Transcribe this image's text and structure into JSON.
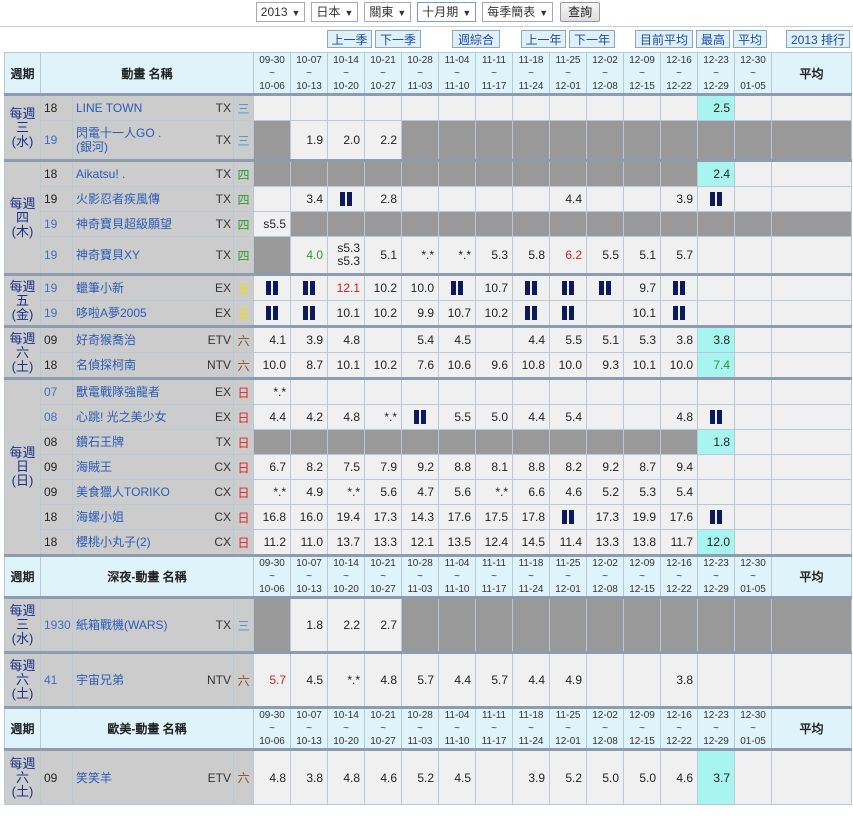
{
  "controls": {
    "year": "2013",
    "country": "日本",
    "region": "關東",
    "period": "十月期",
    "view": "每季簡表",
    "query": "查詢"
  },
  "nav": {
    "prev_season": "上一季",
    "next_season": "下一季",
    "weekly_summary": "週綜合",
    "prev_year": "上一年",
    "next_year": "下一年",
    "current_avg": "目前平均",
    "highest": "最高",
    "average": "平均",
    "ranking": "2013 排行"
  },
  "weeks": [
    [
      "09-30",
      "10-06"
    ],
    [
      "10-07",
      "10-13"
    ],
    [
      "10-14",
      "10-20"
    ],
    [
      "10-21",
      "10-27"
    ],
    [
      "10-28",
      "11-03"
    ],
    [
      "11-04",
      "11-10"
    ],
    [
      "11-11",
      "11-17"
    ],
    [
      "11-18",
      "11-24"
    ],
    [
      "11-25",
      "12-01"
    ],
    [
      "12-02",
      "12-08"
    ],
    [
      "12-09",
      "12-15"
    ],
    [
      "12-16",
      "12-22"
    ],
    [
      "12-23",
      "12-29"
    ],
    [
      "12-30",
      "01-05"
    ]
  ],
  "tilde": "~",
  "colors": {
    "header_bg": "#dff3fb",
    "highlight": "#a8f4f0",
    "blocked": "#999999",
    "red": "#d42020",
    "green": "#2a9a2a"
  },
  "sections": [
    {
      "week_label": "週期",
      "name_label": "動畫 名稱",
      "avg_label": "平均",
      "groups": [
        {
          "day": "每週\n三\n(水)",
          "rows": [
            {
              "time": "18",
              "name": "LINE TOWN",
              "station": "TX",
              "day": "三",
              "dc": "#3399cc",
              "cells": [
                "",
                "",
                "",
                "",
                "",
                "",
                "",
                "",
                "",
                "",
                "",
                "",
                {
                  "v": "2.5",
                  "hl": 1
                },
                ""
              ],
              "avg": ""
            },
            {
              "time": "19",
              "tb": 1,
              "name": "閃電十一人GO .\n(銀河)",
              "station": "TX",
              "day": "三",
              "dc": "#3399cc",
              "cells": [
                "#",
                "1.9",
                "2.0",
                "2.2",
                "#",
                "#",
                "#",
                "#",
                "#",
                "#",
                "#",
                "#",
                "#",
                "#"
              ],
              "avg": "#"
            }
          ]
        },
        {
          "day": "每週\n四\n(木)",
          "rows": [
            {
              "time": "18",
              "name": "Aikatsu! .",
              "station": "TX",
              "day": "四",
              "dc": "#2a9a2a",
              "cells": [
                "#",
                "#",
                "#",
                "#",
                "#",
                "#",
                "#",
                "#",
                "#",
                "#",
                "#",
                "#",
                {
                  "v": "2.4",
                  "hl": 1
                },
                ""
              ],
              "avg": ""
            },
            {
              "time": "19",
              "name": "火影忍者疾風傳",
              "station": "TX",
              "day": "四",
              "dc": "#2a9a2a",
              "cells": [
                "",
                "3.4",
                "||",
                "2.8",
                "",
                "",
                "",
                "",
                "4.4",
                "",
                "",
                "3.9",
                "||",
                ""
              ],
              "avg": ""
            },
            {
              "time": "19",
              "tb": 1,
              "name": "神奇寶貝超級願望",
              "station": "TX",
              "day": "四",
              "dc": "#2a9a2a",
              "cells": [
                "s5.5",
                "#",
                "#",
                "#",
                "#",
                "#",
                "#",
                "#",
                "#",
                "#",
                "#",
                "#",
                "#",
                "#"
              ],
              "avg": "#"
            },
            {
              "time": "19",
              "tb": 1,
              "name": "神奇寶貝XY",
              "station": "TX",
              "day": "四",
              "dc": "#2a9a2a",
              "tall": 1,
              "cells": [
                "#",
                {
                  "v": "4.0",
                  "c": "green"
                },
                "s5.3\ns5.3",
                "5.1",
                "*.*",
                "*.*",
                "5.3",
                "5.8",
                {
                  "v": "6.2",
                  "c": "red"
                },
                "5.5",
                "5.1",
                "5.7",
                "",
                ""
              ],
              "avg": ""
            }
          ]
        },
        {
          "day": "每週\n五\n(金)",
          "rows": [
            {
              "time": "19",
              "tb": 1,
              "name": "蠟筆小新",
              "station": "EX",
              "day": "五",
              "dc": "#e8e000",
              "cells": [
                "||",
                "||",
                {
                  "v": "12.1",
                  "c": "red"
                },
                "10.2",
                "10.0",
                "||",
                "10.7",
                "||",
                "||",
                "||",
                "9.7",
                "||",
                "",
                ""
              ],
              "avg": ""
            },
            {
              "time": "19",
              "tb": 1,
              "name": "哆啦A夢2005",
              "station": "EX",
              "day": "五",
              "dc": "#e8e000",
              "cells": [
                "||",
                "||",
                "10.1",
                "10.2",
                "9.9",
                "10.7",
                "10.2",
                "||",
                "||",
                "",
                "10.1",
                "||",
                "",
                ""
              ],
              "avg": ""
            }
          ]
        },
        {
          "day": "每週\n六\n(土)",
          "rows": [
            {
              "time": "09",
              "name": "好奇猴喬治",
              "station": "ETV",
              "day": "六",
              "dc": "#8a4a1a",
              "cells": [
                "4.1",
                "3.9",
                "4.8",
                "",
                "5.4",
                "4.5",
                "",
                "4.4",
                "5.5",
                "5.1",
                "5.3",
                "3.8",
                {
                  "v": "3.8",
                  "hl": 1
                },
                ""
              ],
              "avg": ""
            },
            {
              "time": "18",
              "name": "名偵探柯南",
              "station": "NTV",
              "day": "六",
              "dc": "#8a4a1a",
              "cells": [
                "10.0",
                "8.7",
                "10.1",
                "10.2",
                "7.6",
                "10.6",
                "9.6",
                "10.8",
                "10.0",
                "9.3",
                "10.1",
                "10.0",
                {
                  "v": "7.4",
                  "hl": 1,
                  "c": "green"
                },
                ""
              ],
              "avg": ""
            }
          ]
        },
        {
          "day": "每週\n日\n(日)",
          "rows": [
            {
              "time": "07",
              "tb": 1,
              "name": "獸電戰隊強龍者",
              "station": "EX",
              "day": "日",
              "dc": "#e02020",
              "cells": [
                "*.*",
                "",
                "",
                "",
                "",
                "",
                "",
                "",
                "",
                "",
                "",
                "",
                "",
                ""
              ],
              "avg": ""
            },
            {
              "time": "08",
              "tb": 1,
              "name": "心跳! 光之美少女",
              "station": "EX",
              "day": "日",
              "dc": "#e02020",
              "cells": [
                "4.4",
                "4.2",
                "4.8",
                "*.*",
                "||",
                "5.5",
                "5.0",
                "4.4",
                "5.4",
                "",
                "",
                "4.8",
                "||",
                ""
              ],
              "avg": ""
            },
            {
              "time": "08",
              "name": "鑽石王牌",
              "station": "TX",
              "day": "日",
              "dc": "#e02020",
              "cells": [
                "#",
                "#",
                "#",
                "#",
                "#",
                "#",
                "#",
                "#",
                "#",
                "#",
                "#",
                "#",
                {
                  "v": "1.8",
                  "hl": 1
                },
                ""
              ],
              "avg": ""
            },
            {
              "time": "09",
              "name": "海賊王",
              "station": "CX",
              "day": "日",
              "dc": "#e02020",
              "cells": [
                "6.7",
                "8.2",
                "7.5",
                "7.9",
                "9.2",
                "8.8",
                "8.1",
                "8.8",
                "8.2",
                "9.2",
                "8.7",
                "9.4",
                "",
                ""
              ],
              "avg": ""
            },
            {
              "time": "09",
              "name": "美食獵人TORIKO",
              "station": "CX",
              "day": "日",
              "dc": "#e02020",
              "cells": [
                "*.*",
                "4.9",
                "*.*",
                "5.6",
                "4.7",
                "5.6",
                "*.*",
                "6.6",
                "4.6",
                "5.2",
                "5.3",
                "5.4",
                "",
                ""
              ],
              "avg": ""
            },
            {
              "time": "18",
              "name": "海螺小姐",
              "station": "CX",
              "day": "日",
              "dc": "#e02020",
              "cells": [
                "16.8",
                "16.0",
                "19.4",
                "17.3",
                "14.3",
                "17.6",
                "17.5",
                "17.8",
                "||",
                "17.3",
                "19.9",
                "17.6",
                "||",
                ""
              ],
              "avg": ""
            },
            {
              "time": "18",
              "name": "櫻桃小丸子(2)",
              "station": "CX",
              "day": "日",
              "dc": "#e02020",
              "cells": [
                "11.2",
                "11.0",
                "13.7",
                "13.3",
                "12.1",
                "13.5",
                "12.4",
                "14.5",
                "11.4",
                "13.3",
                "13.8",
                "11.7",
                {
                  "v": "12.0",
                  "hl": 1
                },
                ""
              ],
              "avg": ""
            }
          ]
        }
      ]
    },
    {
      "week_label": "週期",
      "name_label": "深夜-動畫 名稱",
      "avg_label": "平均",
      "groups": [
        {
          "day": "每週\n三\n(水)",
          "rows": [
            {
              "time": "1930",
              "tb": 1,
              "name": "紙箱戰機(WARS)",
              "station": "TX",
              "day": "三",
              "dc": "#3399cc",
              "big": 1,
              "cells": [
                "#",
                "1.8",
                "2.2",
                "2.7",
                "#",
                "#",
                "#",
                "#",
                "#",
                "#",
                "#",
                "#",
                "#",
                "#"
              ],
              "avg": "#"
            }
          ]
        },
        {
          "day": "每週\n六\n(土)",
          "rows": [
            {
              "time": "41",
              "tb": 1,
              "name": "宇宙兄弟",
              "station": "NTV",
              "day": "六",
              "dc": "#8a4a1a",
              "big": 1,
              "cells": [
                {
                  "v": "5.7",
                  "c": "red"
                },
                "4.5",
                "*.*",
                "4.8",
                "5.7",
                "4.4",
                "5.7",
                "4.4",
                "4.9",
                "",
                "",
                "3.8",
                "",
                ""
              ],
              "avg": ""
            }
          ]
        }
      ]
    },
    {
      "week_label": "週期",
      "name_label": "歐美-動畫 名稱",
      "avg_label": "平均",
      "groups": [
        {
          "day": "每週\n六\n(土)",
          "rows": [
            {
              "time": "09",
              "name": "笑笑羊",
              "station": "ETV",
              "day": "六",
              "dc": "#8a4a1a",
              "big": 1,
              "cells": [
                "4.8",
                "3.8",
                "4.8",
                "4.6",
                "5.2",
                "4.5",
                "",
                "3.9",
                "5.2",
                "5.0",
                "5.0",
                "4.6",
                {
                  "v": "3.7",
                  "hl": 1
                },
                ""
              ],
              "avg": ""
            }
          ]
        }
      ]
    }
  ]
}
